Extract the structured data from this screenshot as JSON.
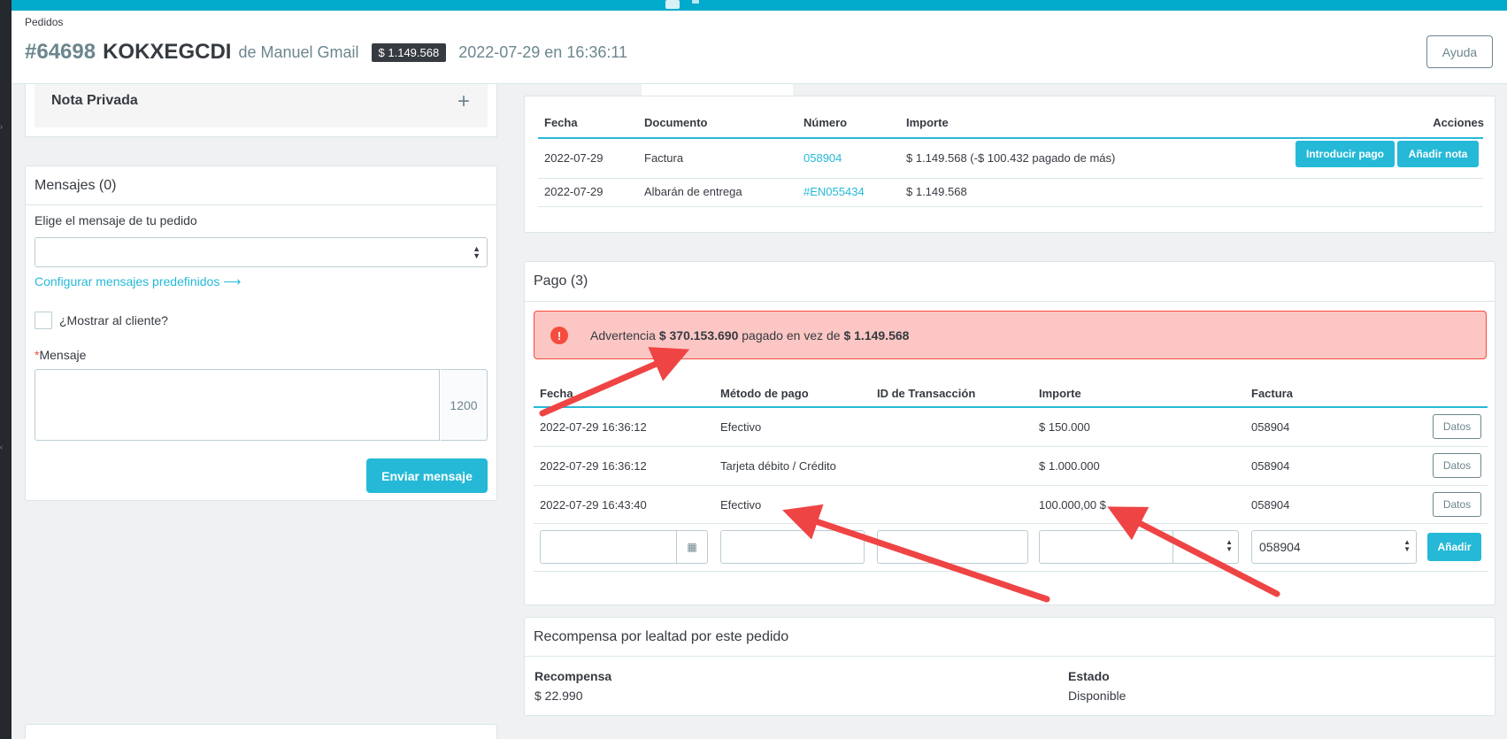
{
  "breadcrumb": "Pedidos",
  "order": {
    "number": "#64698",
    "reference": "KOKXEGCDI",
    "customer": "de Manuel Gmail",
    "total": "$ 1.149.568",
    "date": "2022-07-29 en 16:36:11"
  },
  "help_label": "Ayuda",
  "private_note": {
    "title": "Nota Privada",
    "add_icon": "+"
  },
  "messages": {
    "title": "Mensajes (0)",
    "choose_label": "Elige el mensaje de tu pedido",
    "select_value": "",
    "config_link": "Configurar mensajes predefinidos ⟶",
    "show_customer_label": "¿Mostrar al cliente?",
    "required_mark": "*",
    "message_label": "Mensaje",
    "message_value": "",
    "counter": "1200",
    "send_label": "Enviar mensaje"
  },
  "documents": {
    "headers": [
      "Fecha",
      "Documento",
      "Número",
      "Importe",
      "Acciones"
    ],
    "rows": [
      {
        "date": "2022-07-29",
        "doc": "Factura",
        "number": "058904",
        "amount": "$ 1.149.568 (-$ 100.432 pagado de más)"
      },
      {
        "date": "2022-07-29",
        "doc": "Albarán de entrega",
        "number": "#EN055434",
        "amount": "$ 1.149.568"
      }
    ],
    "btn_payment": "Introducir pago",
    "btn_note": "Añadir nota"
  },
  "payments": {
    "title": "Pago (3)",
    "alert": {
      "prefix": "Advertencia",
      "paid": "$ 370.153.690",
      "middle": "pagado en vez de",
      "expected": "$ 1.149.568"
    },
    "headers": [
      "Fecha",
      "Método de pago",
      "ID de Transacción",
      "Importe",
      "Factura"
    ],
    "rows": [
      {
        "date": "2022-07-29 16:36:12",
        "method": "Efectivo",
        "txn": "",
        "amount": "$ 150.000",
        "invoice": "058904",
        "btn": "Datos"
      },
      {
        "date": "2022-07-29 16:36:12",
        "method": "Tarjeta débito / Crédito",
        "txn": "",
        "amount": "$ 1.000.000",
        "invoice": "058904",
        "btn": "Datos"
      },
      {
        "date": "2022-07-29 16:43:40",
        "method": "Efectivo",
        "txn": "",
        "amount": "100.000,00 $",
        "invoice": "058904",
        "btn": "Datos"
      }
    ],
    "new_row": {
      "invoice_value": "058904",
      "add_label": "Añadir"
    }
  },
  "reward": {
    "title": "Recompensa por lealtad por este pedido",
    "reward_label": "Recompensa",
    "reward_value": "$ 22.990",
    "status_label": "Estado",
    "status_value": "Disponible"
  },
  "colors": {
    "primary": "#25b9d7",
    "danger": "#f54c3e",
    "danger_bg": "#fbc6c3",
    "annotation_arrow": "#ef4444"
  }
}
